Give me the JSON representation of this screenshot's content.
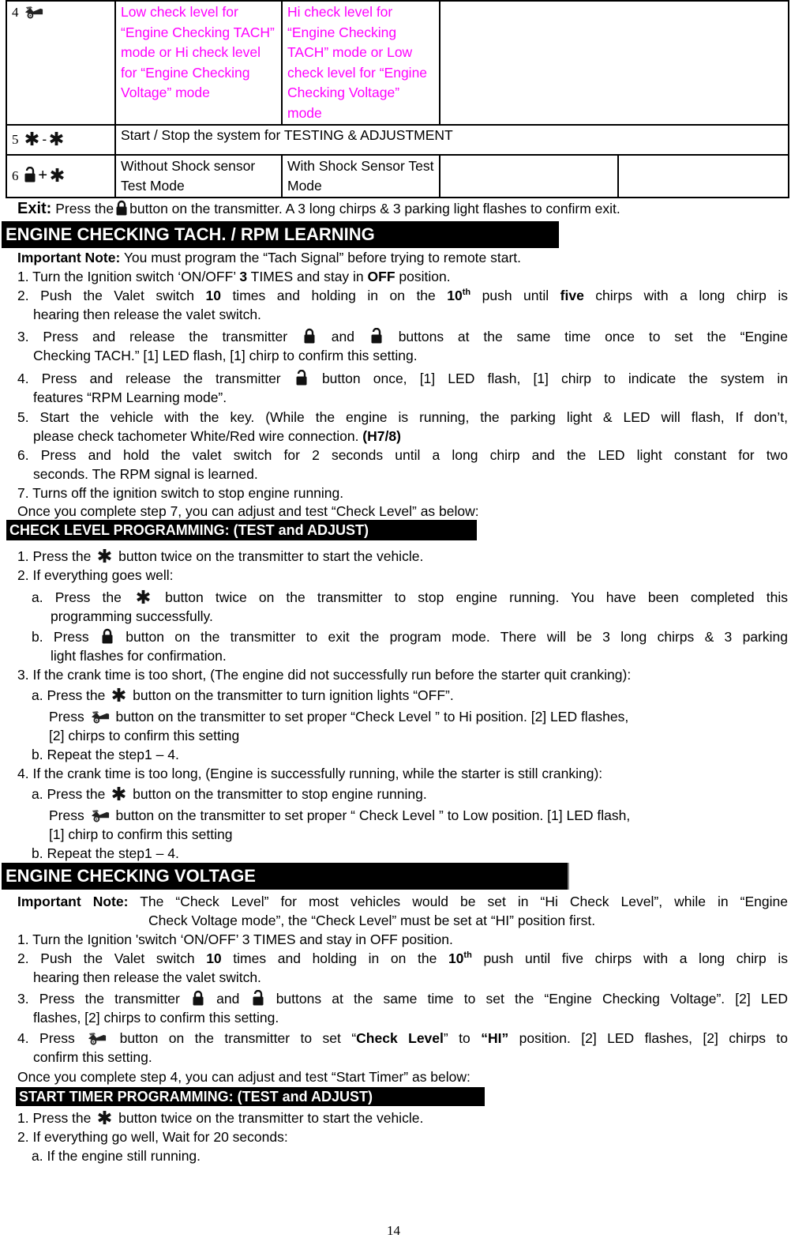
{
  "table": {
    "rows": [
      {
        "number": "4",
        "icon": "car-trunk-icon",
        "col1": "Low check level for “Engine Checking TACH” mode or Hi check level for “Engine Checking Voltage” mode",
        "col2": "Hi check level for “Engine Checking TACH” mode or Low check level for “Engine Checking Voltage” mode",
        "col3": ""
      },
      {
        "number": "5",
        "icons": [
          "asterisk-icon",
          "asterisk-icon"
        ],
        "separator": "-",
        "span": "Start / Stop the system for TESTING & ADJUSTMENT"
      },
      {
        "number": "6",
        "icons": [
          "unlock-icon",
          "asterisk-icon"
        ],
        "separator": "+",
        "col1": "Without Shock sensor Test Mode",
        "col2": "With Shock Sensor Test Mode",
        "col3": "",
        "col4": ""
      }
    ]
  },
  "exit": {
    "label": "Exit:",
    "pre": "Press the",
    "post": "button on the transmitter. A 3 long chirps & 3 parking light flashes to confirm exit."
  },
  "sections": {
    "tach": {
      "title": "ENGINE CHECKING TACH. / RPM LEARNING",
      "note_label": "Important Note:",
      "note": "You must program the “Tach Signal” before trying to remote start.",
      "s1a": "1. Turn the Ignition switch ‘ON/OFF’ ",
      "s1b": "3",
      "s1c": " TIMES and stay in ",
      "s1d": "OFF",
      "s1e": " position.",
      "s2a": "2. Push the Valet switch ",
      "s2b": "10",
      "s2c": " times and holding in on the ",
      "s2d": "10",
      "s2sup": "th",
      "s2e": " push until ",
      "s2f": "five",
      "s2g": " chirps with a long chirp is",
      "s2line2": "hearing then release the valet switch.",
      "s3a": "3. Press and release the transmitter",
      "s3b": "and",
      "s3c": "buttons at the same time once to set the “Engine",
      "s3line2": "Checking TACH.” [1] LED flash, [1] chirp to confirm this setting.",
      "s4a": "4. Press and release the transmitter",
      "s4b": "button once, [1] LED flash, [1] chirp to indicate the system in",
      "s4line2": "features “RPM Learning mode”.",
      "s5": "5. Start the vehicle with the key. (While the engine is running, the parking light & LED will flash, If don’t,",
      "s5line2": "please check tachometer White/Red wire connection. ",
      "s5bold": "(H7/8)",
      "s6": "6. Press and hold the valet switch for 2 seconds until a long chirp and the LED light constant for two",
      "s6line2": "seconds. The RPM signal is learned.",
      "s7": "7. Turns off the ignition switch to stop engine running.",
      "once": "Once you complete step 7, you can adjust and test “Check Level” as below:"
    },
    "check_level": {
      "title": "CHECK LEVEL PROGRAMMING: (TEST and ADJUST)",
      "s1a": "1. Press the",
      "s1b": "button twice on the transmitter to start the vehicle.",
      "s2": "2. If everything goes well:",
      "s2a_a": "a. Press the",
      "s2a_b": "button twice on the transmitter to stop engine running. You have been completed this",
      "s2a_line2": "programming successfully.",
      "s2b_a": "b. Press",
      "s2b_b": "button on the transmitter to exit the program mode. There will be 3 long chirps & 3 parking",
      "s2b_line2": "light flashes for confirmation.",
      "s3": "3. If the crank time is too short, (The engine did not successfully run before the starter quit cranking):",
      "s3a_a": "a. Press the",
      "s3a_b": "button on the transmitter to turn ignition lights “OFF”.",
      "s3a2_a": "Press",
      "s3a2_b": "button on the transmitter to set proper “Check Level ” to Hi position. [2] LED flashes,",
      "s3a2_line2": "[2] chirps to confirm this setting",
      "s3b": "b. Repeat the step1 – 4.",
      "s4": "4. If the crank time is too long, (Engine is successfully running, while the starter is still cranking):",
      "s4a_a": "a. Press the",
      "s4a_b": "button on the transmitter to stop engine running.",
      "s4a2_a": "Press",
      "s4a2_b": "button on the transmitter to set proper “ Check Level ” to Low position. [1] LED flash,",
      "s4a2_line2": "[1] chirp to confirm this setting",
      "s4b": "b. Repeat the step1 – 4."
    },
    "voltage": {
      "title": "ENGINE CHECKING VOLTAGE",
      "note_label": "Important Note:",
      "note_line1": "The “Check Level” for most vehicles would be set in “Hi Check Level”, while in “Engine",
      "note_bold_quote": "”,",
      "note_line2": "Check Voltage mode”, the “Check Level” must be set at “HI” position first.",
      "s1": "1. Turn the Ignition 'switch ‘ON/OFF’ 3 TIMES and stay in OFF position.",
      "s2a": "2. Push the Valet switch ",
      "s2b": "10",
      "s2c": " times and holding in on the ",
      "s2d": "10",
      "s2sup": "th",
      "s2e": " push until five chirps with a long chirp is",
      "s2line2": "hearing then release the valet switch.",
      "s3a": "3. Press the transmitter",
      "s3b": "and",
      "s3c": "buttons at the same time to set the “Engine Checking Voltage”. [2] LED",
      "s3line2": "flashes, [2] chirps to confirm this setting.",
      "s4a": "4. Press",
      "s4b": "button on the transmitter to set “",
      "s4c": "Check Level",
      "s4d": "” to ",
      "s4e": "“HI”",
      "s4f": " position. [2] LED flashes, [2] chirps to",
      "s4line2": "confirm this setting.",
      "once": "Once you complete step 4, you can adjust and test “Start Timer” as below:"
    },
    "start_timer": {
      "title": "START TIMER PROGRAMMING: (TEST and ADJUST)",
      "s1a": "1. Press the",
      "s1b": "button twice on the transmitter to start the vehicle.",
      "s2": "2. If everything go well, Wait for 20 seconds:",
      "s2a": "a. If the engine still running."
    }
  },
  "page_number": "14",
  "colors": {
    "highlight_text": "#ff00ff",
    "header_bg": "#000000",
    "header_text": "#ffffff"
  }
}
